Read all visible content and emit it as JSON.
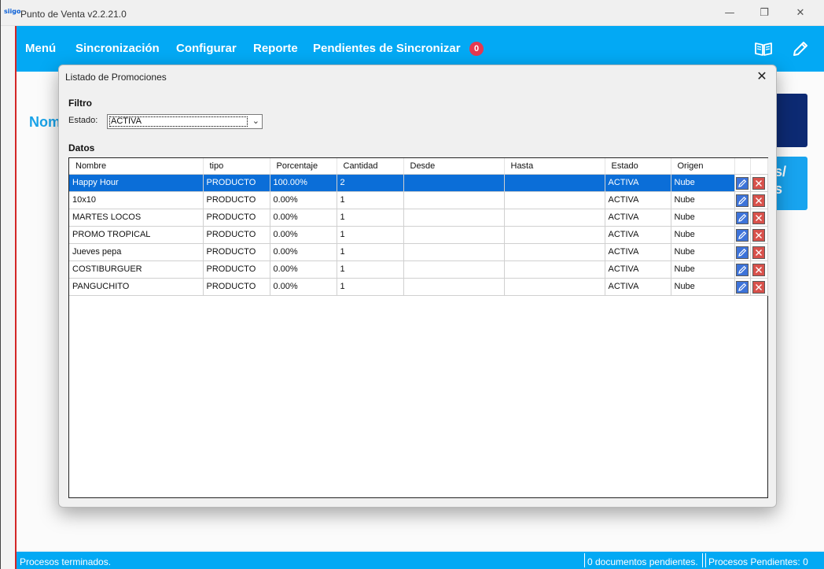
{
  "window": {
    "logo_text": "siigo",
    "title": "Punto de Venta v2.2.21.0",
    "minimize_glyph": "—",
    "restore_glyph": "❐",
    "close_glyph": "✕"
  },
  "menubar": {
    "items": [
      "Menú",
      "Sincronización",
      "Configurar",
      "Reporte",
      "Pendientes de Sincronizar"
    ],
    "pending_badge": "0",
    "right_icons": [
      "book-icon",
      "pencil-icon"
    ]
  },
  "background": {
    "label_partial": "Nom",
    "tile_text_partial": [
      "s/",
      "s"
    ]
  },
  "dialog": {
    "title": "Listado de Promociones",
    "close_glyph": "✕",
    "filter_section": "Filtro",
    "estado_label": "Estado:",
    "estado_value": "ACTIVA",
    "data_section": "Datos"
  },
  "table": {
    "columns": [
      "Nombre",
      "tipo",
      "Porcentaje",
      "Cantidad",
      "Desde",
      "Hasta",
      "Estado",
      "Origen"
    ],
    "rows": [
      {
        "nombre": "Happy Hour",
        "tipo": "PRODUCTO",
        "porcentaje": "100.00%",
        "cantidad": "2",
        "desde": "",
        "hasta": "",
        "estado": "ACTIVA",
        "origen": "Nube",
        "selected": true
      },
      {
        "nombre": "10x10",
        "tipo": "PRODUCTO",
        "porcentaje": "0.00%",
        "cantidad": "1",
        "desde": "",
        "hasta": "",
        "estado": "ACTIVA",
        "origen": "Nube"
      },
      {
        "nombre": "MARTES LOCOS",
        "tipo": "PRODUCTO",
        "porcentaje": "0.00%",
        "cantidad": "1",
        "desde": "",
        "hasta": "",
        "estado": "ACTIVA",
        "origen": "Nube"
      },
      {
        "nombre": "PROMO TROPICAL",
        "tipo": "PRODUCTO",
        "porcentaje": "0.00%",
        "cantidad": "1",
        "desde": "",
        "hasta": "",
        "estado": "ACTIVA",
        "origen": "Nube"
      },
      {
        "nombre": "Jueves pepa",
        "tipo": "PRODUCTO",
        "porcentaje": "0.00%",
        "cantidad": "1",
        "desde": "",
        "hasta": "",
        "estado": "ACTIVA",
        "origen": "Nube"
      },
      {
        "nombre": "COSTIBURGUER",
        "tipo": "PRODUCTO",
        "porcentaje": "0.00%",
        "cantidad": "1",
        "desde": "",
        "hasta": "",
        "estado": "ACTIVA",
        "origen": "Nube"
      },
      {
        "nombre": "PANGUCHITO",
        "tipo": "PRODUCTO",
        "porcentaje": "0.00%",
        "cantidad": "1",
        "desde": "",
        "hasta": "",
        "estado": "ACTIVA",
        "origen": "Nube"
      }
    ]
  },
  "statusbar": {
    "left": "Procesos terminados.",
    "documents": "0 documentos pendientes.",
    "processes": "Procesos Pendientes: 0"
  },
  "colors": {
    "accent": "#03a9f4",
    "selection": "#0b6ed8",
    "badge": "#e53950",
    "edit_button": "#3d73d9",
    "delete_button": "#d8514b"
  }
}
